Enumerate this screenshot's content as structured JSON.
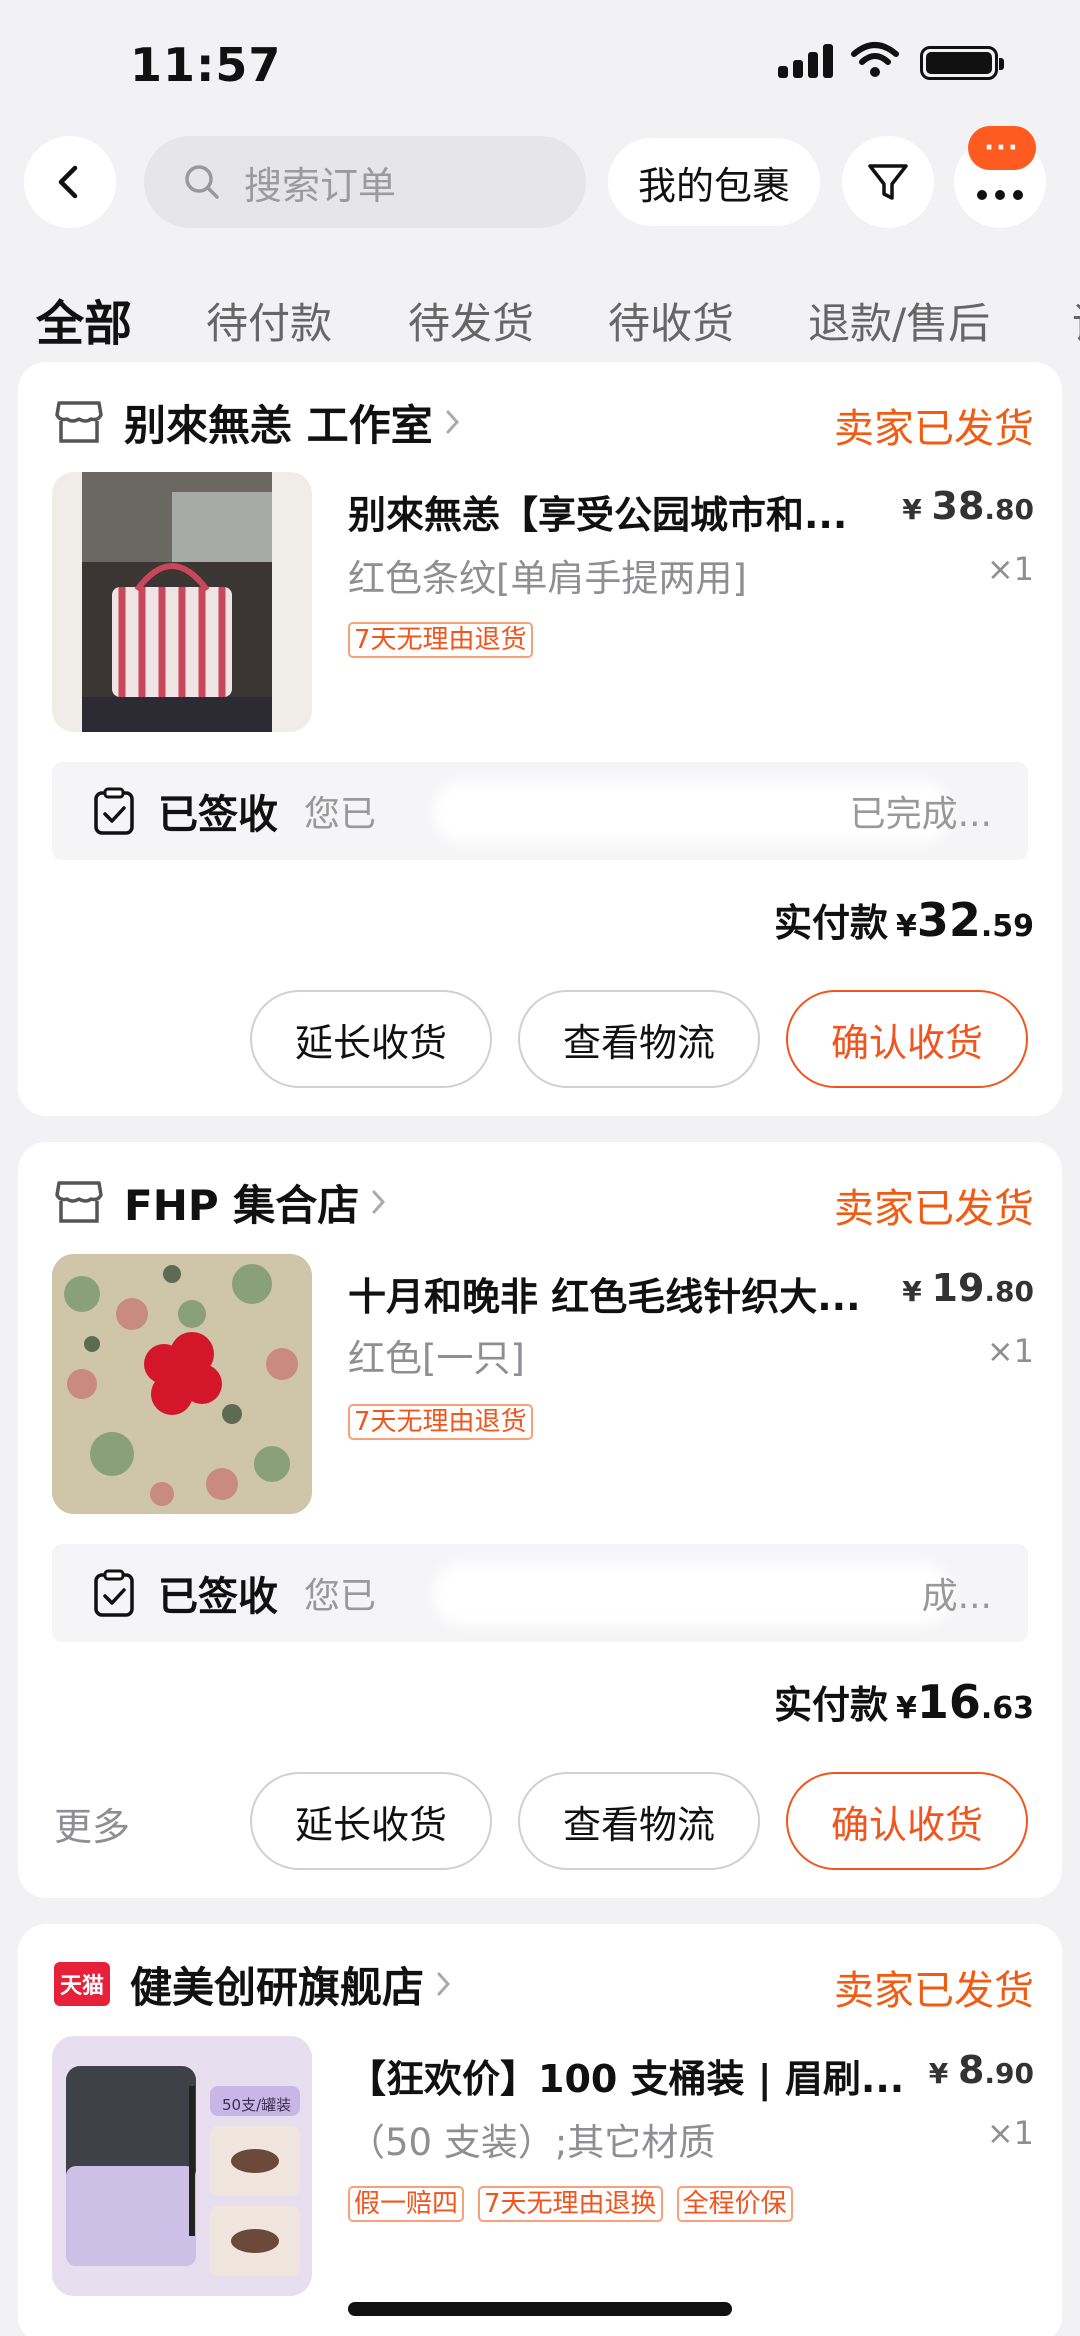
{
  "status_bar": {
    "time": "11:57"
  },
  "header": {
    "search_placeholder": "搜索订单",
    "packages_label": "我的包裹",
    "message_badge": "···"
  },
  "tabs": [
    {
      "label": "全部",
      "active": true
    },
    {
      "label": "待付款",
      "active": false
    },
    {
      "label": "待发货",
      "active": false
    },
    {
      "label": "待收货",
      "active": false
    },
    {
      "label": "退款/售后",
      "active": false
    },
    {
      "label": "评",
      "active": false
    }
  ],
  "orders": [
    {
      "shop": "别來無恙 工作室",
      "status": "卖家已发货",
      "product_title": "别來無恙【享受公园城市和...",
      "spec": "红色条纹[单肩手提两用]",
      "price_symbol": "¥",
      "price_int": "38",
      "price_dec": ".80",
      "qty": "×1",
      "tags": [
        "7天无理由退货"
      ],
      "signed_label": "已签收",
      "signed_desc": "您已",
      "signed_tail": "已完成...",
      "paid_label": "实付款",
      "paid_symbol": "¥",
      "paid_int": "32",
      "paid_dec": ".59",
      "buttons": [
        "延长收货",
        "查看物流",
        "确认收货"
      ]
    },
    {
      "shop": "FHP 集合店",
      "status": "卖家已发货",
      "product_title": "十月和晚非 红色毛线针织大...",
      "spec": "红色[一只]",
      "price_symbol": "¥",
      "price_int": "19",
      "price_dec": ".80",
      "qty": "×1",
      "tags": [
        "7天无理由退货"
      ],
      "signed_label": "已签收",
      "signed_desc": "您已",
      "signed_tail": "成...",
      "paid_label": "实付款",
      "paid_symbol": "¥",
      "paid_int": "16",
      "paid_dec": ".63",
      "more": "更多",
      "buttons": [
        "延长收货",
        "查看物流",
        "确认收货"
      ]
    },
    {
      "shop": "健美创研旗舰店",
      "shop_badge": "天猫",
      "status": "卖家已发货",
      "product_title": "【狂欢价】100 支桶装 | 眉刷...",
      "spec": "（50 支装）;其它材质",
      "price_symbol": "¥",
      "price_int": "8",
      "price_dec": ".90",
      "qty": "×1",
      "tags": [
        "假一赔四",
        "7天无理由退换",
        "全程价保"
      ],
      "thumb_label": "50支/罐装"
    }
  ],
  "colors": {
    "accent": "#f25b12",
    "background": "#f2f2f4",
    "tmall_red": "#e8213a"
  },
  "icons": [
    "back-arrow-icon",
    "search-icon",
    "filter-icon",
    "more-dots-icon",
    "store-icon",
    "clipboard-check-icon",
    "chevron-right-icon"
  ]
}
